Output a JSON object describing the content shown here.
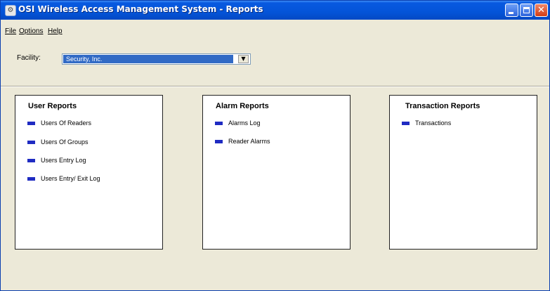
{
  "window": {
    "title": "OSI Wireless Access Management System - Reports",
    "app_icon": "app-icon"
  },
  "menu": {
    "file": "File",
    "options": "Options",
    "help": "Help"
  },
  "facility": {
    "label": "Facility:",
    "selected": "Security, Inc."
  },
  "user_reports": {
    "title": "User Reports",
    "items": [
      "Users Of Readers",
      "Users Of Groups",
      "Users Entry Log",
      "Users Entry/ Exit Log"
    ]
  },
  "alarm_reports": {
    "title": "Alarm Reports",
    "items": [
      "Alarms Log",
      "Reader Alarms"
    ]
  },
  "transaction_reports": {
    "title": "Transaction Reports",
    "items": [
      "Transactions"
    ]
  },
  "colors": {
    "titlebar": "#0454d8",
    "bullet": "#1f2bc2",
    "selection": "#316ac5",
    "window_bg": "#ece9d8"
  }
}
